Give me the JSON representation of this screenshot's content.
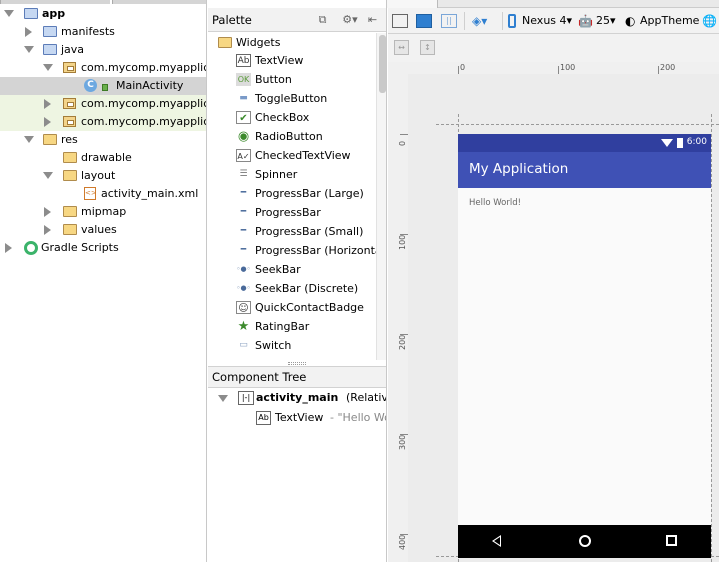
{
  "project_tree": {
    "items": [
      {
        "label": "app",
        "bold": true
      },
      {
        "label": "manifests"
      },
      {
        "label": "java"
      },
      {
        "label": "com.mycomp.myapplication"
      },
      {
        "label": "MainActivity",
        "icon_letter": "C"
      },
      {
        "label": "com.mycomp.myapplication (androidTest)"
      },
      {
        "label": "com.mycomp.myapplication (test)"
      },
      {
        "label": "res"
      },
      {
        "label": "drawable"
      },
      {
        "label": "layout"
      },
      {
        "label": "activity_main.xml",
        "icon_letter": "<>"
      },
      {
        "label": "mipmap"
      },
      {
        "label": "values"
      },
      {
        "label": "Gradle Scripts"
      }
    ]
  },
  "palette": {
    "title": "Palette",
    "group": "Widgets",
    "items": [
      {
        "label": "TextView",
        "icon": "Ab"
      },
      {
        "label": "Button",
        "icon": "OK"
      },
      {
        "label": "ToggleButton",
        "icon": "▬"
      },
      {
        "label": "CheckBox",
        "icon": "✔"
      },
      {
        "label": "RadioButton",
        "icon": "◉"
      },
      {
        "label": "CheckedTextView",
        "icon": "A✓"
      },
      {
        "label": "Spinner",
        "icon": "☰"
      },
      {
        "label": "ProgressBar (Large)",
        "icon": "━"
      },
      {
        "label": "ProgressBar",
        "icon": "━"
      },
      {
        "label": "ProgressBar (Small)",
        "icon": "━"
      },
      {
        "label": "ProgressBar (Horizontal)",
        "icon": "━"
      },
      {
        "label": "SeekBar",
        "icon": "◦●◦"
      },
      {
        "label": "SeekBar (Discrete)",
        "icon": "◦●◦"
      },
      {
        "label": "QuickContactBadge",
        "icon": "☺"
      },
      {
        "label": "RatingBar",
        "icon": "★"
      },
      {
        "label": "Switch",
        "icon": "▭"
      }
    ]
  },
  "component_tree": {
    "title": "Component Tree",
    "root_name": "activity_main",
    "root_type": "(RelativeLayout)",
    "child_name": "TextView",
    "child_detail": "- \"Hello World!\""
  },
  "toolbar": {
    "device": "Nexus 4",
    "api": "25",
    "theme": "AppTheme"
  },
  "rulers": {
    "h_ticks": [
      "0",
      "100",
      "200"
    ],
    "v_ticks": [
      "0",
      "100",
      "200",
      "300",
      "400"
    ]
  },
  "device_preview": {
    "time": "6:00",
    "app_title": "My Application",
    "body_text": "Hello World!"
  }
}
